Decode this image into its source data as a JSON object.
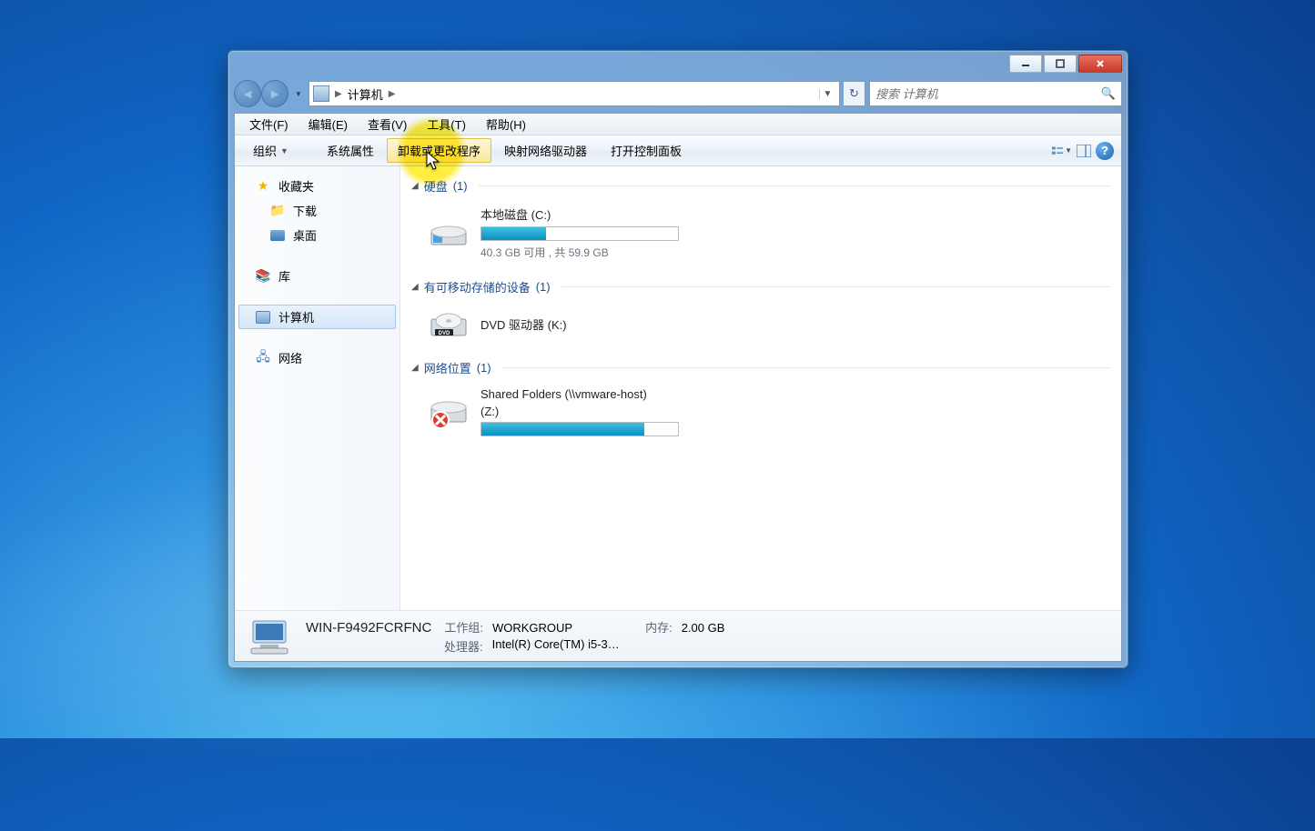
{
  "window": {
    "minimize": "–",
    "maximize": "□",
    "close": "X"
  },
  "nav": {
    "location": "计算机",
    "search_placeholder": "搜索 计算机"
  },
  "menubar": {
    "file": "文件(F)",
    "edit": "编辑(E)",
    "view": "查看(V)",
    "tools": "工具(T)",
    "help": "帮助(H)"
  },
  "toolbar": {
    "organize": "组织",
    "sys_props": "系统属性",
    "uninstall": "卸载或更改程序",
    "map_drive": "映射网络驱动器",
    "open_cp": "打开控制面板"
  },
  "sidebar": {
    "favorites": "收藏夹",
    "downloads": "下载",
    "desktop": "桌面",
    "libraries": "库",
    "computer": "计算机",
    "network": "网络"
  },
  "groups": {
    "hdd": {
      "title": "硬盘",
      "count": "(1)"
    },
    "removable": {
      "title": "有可移动存储的设备",
      "count": "(1)"
    },
    "network": {
      "title": "网络位置",
      "count": "(1)"
    }
  },
  "drives": {
    "c": {
      "name": "本地磁盘 (C:)",
      "free_text": "40.3 GB 可用 , 共 59.9 GB",
      "fill_pct": 33
    },
    "k": {
      "name": "DVD 驱动器 (K:)"
    },
    "z": {
      "name": "Shared Folders (\\\\vmware-host)",
      "letter": "(Z:)",
      "fill_pct": 83
    }
  },
  "details": {
    "computer_name": "WIN-F9492FCRFNC",
    "workgroup_label": "工作组:",
    "workgroup": "WORKGROUP",
    "memory_label": "内存:",
    "memory": "2.00 GB",
    "cpu_label": "处理器:",
    "cpu": "Intel(R) Core(TM) i5-3…"
  }
}
